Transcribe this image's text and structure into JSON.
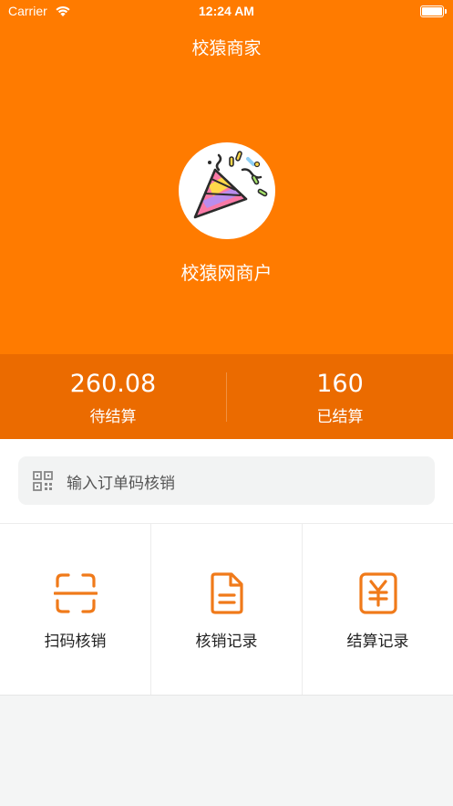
{
  "status_bar": {
    "carrier": "Carrier",
    "time": "12:24 AM"
  },
  "nav": {
    "title": "校猿商家"
  },
  "profile": {
    "name": "校猿网商户",
    "avatar_icon": "party-popper-icon"
  },
  "stats": [
    {
      "value": "260.08",
      "label": "待结算"
    },
    {
      "value": "160",
      "label": "已结算"
    }
  ],
  "search": {
    "placeholder": "输入订单码核销",
    "icon": "qr-code-icon"
  },
  "actions": [
    {
      "label": "扫码核销",
      "icon": "scan-icon"
    },
    {
      "label": "核销记录",
      "icon": "document-icon"
    },
    {
      "label": "结算记录",
      "icon": "yen-receipt-icon"
    }
  ],
  "colors": {
    "brand": "#ff7b00",
    "brand_dark": "#eb6b00",
    "accent_icon": "#f07a1a"
  }
}
